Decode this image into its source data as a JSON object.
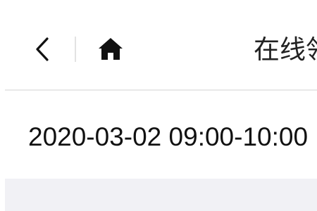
{
  "nav": {
    "back_icon": "chevron-left-icon",
    "home_icon": "home-icon",
    "title": "在线领"
  },
  "session": {
    "time_range": "2020-03-02 09:00-10:00"
  },
  "colors": {
    "background": "#ffffff",
    "text": "#111111",
    "divider": "#e8e8e8",
    "panel": "#f1f1f5"
  }
}
